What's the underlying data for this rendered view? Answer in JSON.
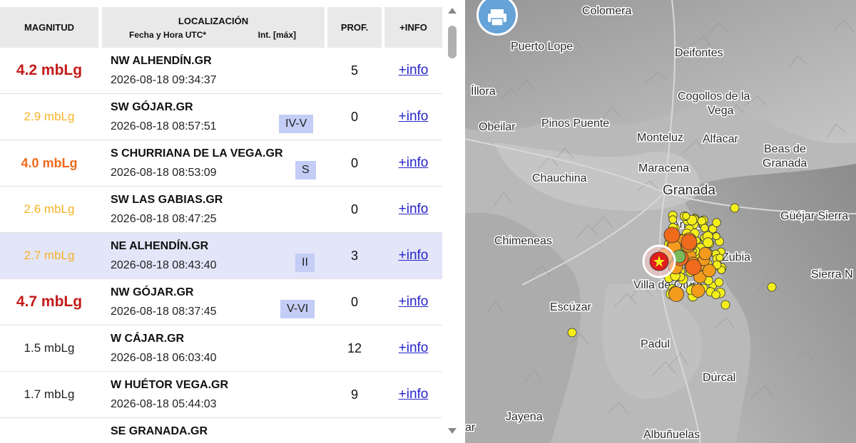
{
  "colors": {
    "big": "#c41a1a",
    "medium": "#f06a1c",
    "small": "#f6b326",
    "neutral": "#222222",
    "link": "#2525c9",
    "selected": "#e3e5f9"
  },
  "headers": {
    "magnitude": "MAGNITUD",
    "location": "LOCALIZACIÓN",
    "datetime": "Fecha y Hora UTC*",
    "intensity": "Int. [máx]",
    "depth": "PROF.",
    "info": "+INFO"
  },
  "events": [
    {
      "magnitude": "4.2 mbLg",
      "level": "big",
      "place": "NW ALHENDÍN.GR",
      "datetime": "2026-08-18 09:34:37",
      "intensity": "",
      "depth": "5",
      "info": "+info"
    },
    {
      "magnitude": "2.9 mbLg",
      "level": "small",
      "place": "SW GÓJAR.GR",
      "datetime": "2026-08-18 08:57:51",
      "intensity": "IV-V",
      "depth": "0",
      "info": "+info"
    },
    {
      "magnitude": "4.0 mbLg",
      "level": "medium",
      "place": "S CHURRIANA DE LA VEGA.GR",
      "datetime": "2026-08-18 08:53:09",
      "intensity": "S",
      "depth": "0",
      "info": "+info"
    },
    {
      "magnitude": "2.6 mbLg",
      "level": "small",
      "place": "SW LAS GABIAS.GR",
      "datetime": "2026-08-18 08:47:25",
      "intensity": "",
      "depth": "0",
      "info": "+info"
    },
    {
      "magnitude": "2.7 mbLg",
      "level": "small",
      "place": "NE ALHENDÍN.GR",
      "datetime": "2026-08-18 08:43:40",
      "intensity": "II",
      "depth": "3",
      "info": "+info",
      "selected": true
    },
    {
      "magnitude": "4.7 mbLg",
      "level": "big",
      "place": "NW GÓJAR.GR",
      "datetime": "2026-08-18 08:37:45",
      "intensity": "V-VI",
      "depth": "0",
      "info": "+info"
    },
    {
      "magnitude": "1.5 mbLg",
      "level": "neutral",
      "place": "W CÁJAR.GR",
      "datetime": "2026-08-18 06:03:40",
      "intensity": "",
      "depth": "12",
      "info": "+info"
    },
    {
      "magnitude": "1.7 mbLg",
      "level": "neutral",
      "place": "W HUÉTOR VEGA.GR",
      "datetime": "2026-08-18 05:44:03",
      "intensity": "",
      "depth": "9",
      "info": "+info"
    },
    {
      "magnitude": "",
      "level": "neutral",
      "place": "SE GRANADA.GR",
      "datetime": "",
      "intensity": "",
      "depth": "",
      "info": ""
    }
  ],
  "map": {
    "print_icon": "printer-icon",
    "labels": [
      "Colomera",
      "Puerto Lope",
      "Deifontes",
      "Íllora",
      "Cogollos de la Vega",
      "Obeilar",
      "Pinos Puente",
      "Monteluz",
      "Alfacar",
      "Beas de Granada",
      "Maracena",
      "Chauchina",
      "Granada",
      "Güéjar Sierra",
      "Chimeneas",
      "Sierra N",
      "Escúzar",
      "Padul",
      "Dúrcal",
      "Jayena",
      "Albuñuelas",
      "ar",
      "Armilla",
      "Zubia",
      "Villa de Otura"
    ]
  }
}
